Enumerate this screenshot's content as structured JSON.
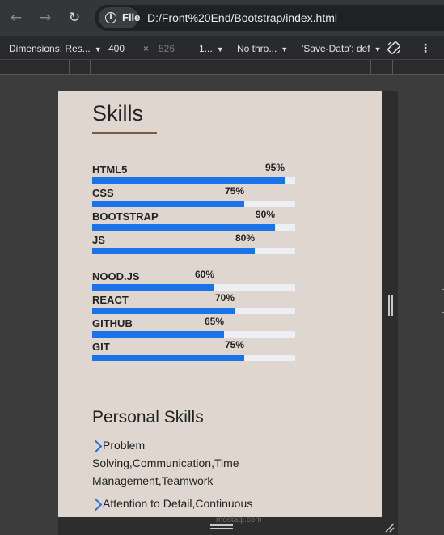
{
  "browser": {
    "file_label": "File",
    "url": "D:/Front%20End/Bootstrap/index.html"
  },
  "devtools": {
    "dimensions_label": "Dimensions: Res...",
    "width": "400",
    "x_separator": "×",
    "height": "526",
    "zoom": "1...",
    "throttle": "No thro...",
    "save_data": "'Save-Data': def"
  },
  "page": {
    "skills_title": "Skills",
    "skills": [
      {
        "name": "HTML5",
        "percent_label": "95%",
        "percent": 95
      },
      {
        "name": "CSS",
        "percent_label": "75%",
        "percent": 75
      },
      {
        "name": "BOOTSTRAP",
        "percent_label": "90%",
        "percent": 90
      },
      {
        "name": "JS",
        "percent_label": "80%",
        "percent": 80
      },
      {
        "name": "NOOD.JS",
        "percent_label": "60%",
        "percent": 60
      },
      {
        "name": "REACT",
        "percent_label": "70%",
        "percent": 70
      },
      {
        "name": "GITHUB",
        "percent_label": "65%",
        "percent": 65
      },
      {
        "name": "GIT",
        "percent_label": "75%",
        "percent": 75
      }
    ],
    "personal_title": "Personal Skills",
    "personal_items": [
      "Problem Solving,Communication,Time Management,Teamwork",
      "Attention to Detail,Continuous"
    ]
  },
  "watermark": "mostaql.com",
  "colors": {
    "progress_fill": "#1a73e8",
    "progress_track": "#eeeff2",
    "page_background": "#dfd7cf",
    "underline": "#7b5b43"
  },
  "icons": [
    "back-arrow-icon",
    "forward-arrow-icon",
    "reload-icon",
    "info-icon",
    "caret-down-icon",
    "rotate-icon",
    "more-vert-icon",
    "chevron-right-icon"
  ]
}
